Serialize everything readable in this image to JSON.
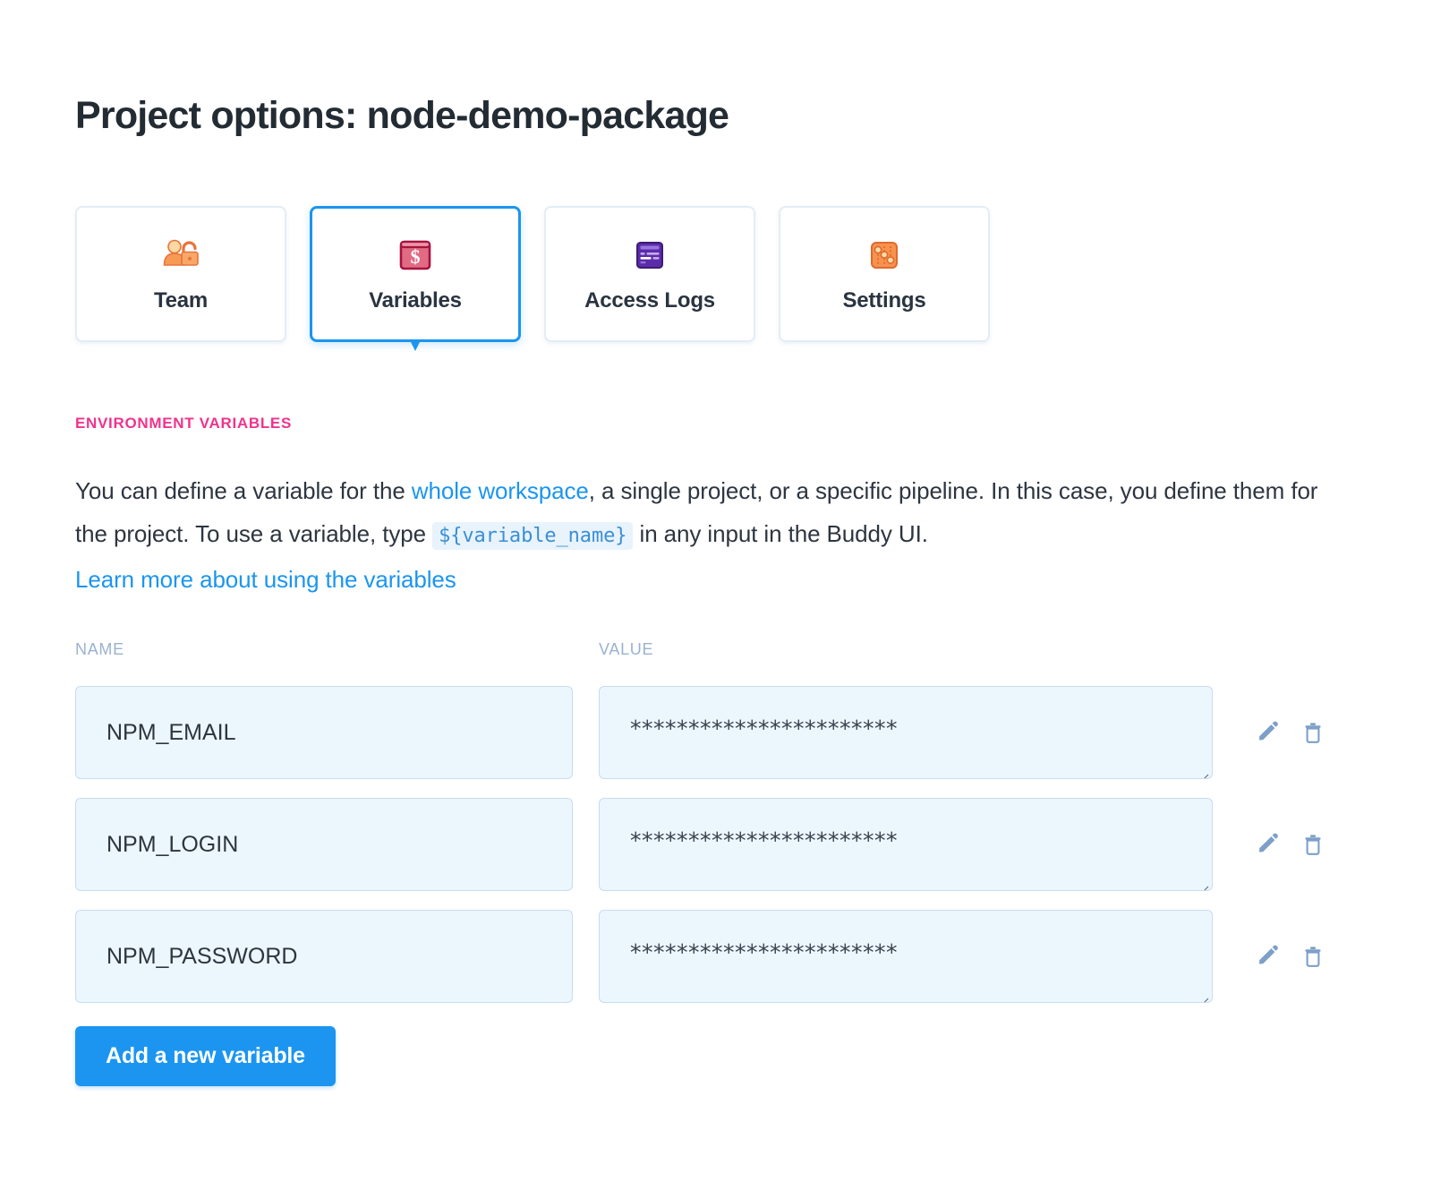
{
  "page": {
    "title": "Project options: node-demo-package"
  },
  "tabs": [
    {
      "label": "Team",
      "icon": "team-lock-icon",
      "active": false
    },
    {
      "label": "Variables",
      "icon": "dollar-card-icon",
      "active": true
    },
    {
      "label": "Access Logs",
      "icon": "log-lines-icon",
      "active": false
    },
    {
      "label": "Settings",
      "icon": "sliders-icon",
      "active": false
    }
  ],
  "section": {
    "heading": "ENVIRONMENT VARIABLES",
    "desc_part1": "You can define a variable for the ",
    "desc_link1": "whole workspace",
    "desc_part2": ", a single project, or a specific pipeline. In this case, you define them for the project. To use a variable, type ",
    "desc_code": "${variable_name}",
    "desc_part3": " in any input in the Buddy UI.",
    "learn_more": "Learn more about using the variables"
  },
  "table": {
    "columns": {
      "name": "NAME",
      "value": "VALUE"
    },
    "rows": [
      {
        "name": "NPM_EMAIL",
        "value": "***********************"
      },
      {
        "name": "NPM_LOGIN",
        "value": "***********************"
      },
      {
        "name": "NPM_PASSWORD",
        "value": "***********************"
      }
    ]
  },
  "actions": {
    "add_label": "Add a new variable",
    "edit_icon": "pencil-icon",
    "delete_icon": "trash-icon"
  },
  "colors": {
    "accent_blue": "#1b95f0",
    "heading_pink": "#f0338d",
    "field_bg": "#ecf6fd",
    "field_border": "#c6ddf2",
    "icon_blue_gray": "#7e9fc8",
    "column_head": "#9ab2d0"
  }
}
